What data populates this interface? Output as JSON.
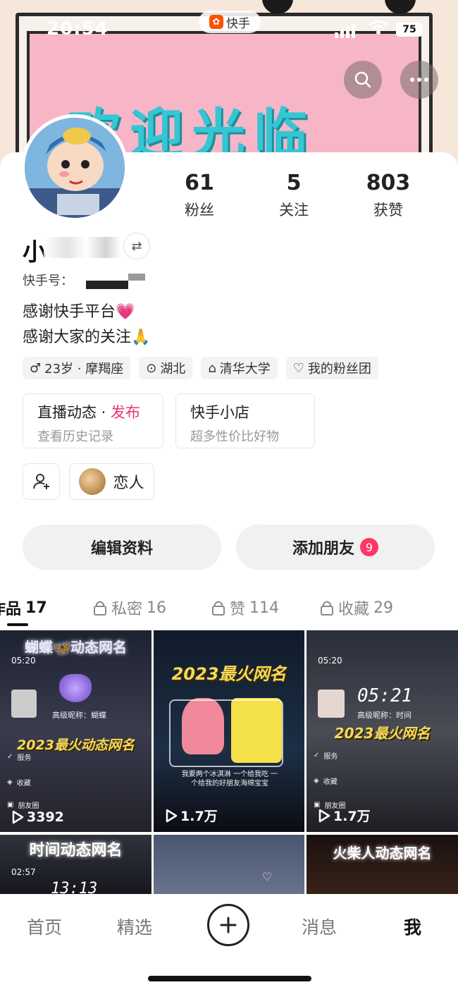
{
  "status_bar": {
    "time": "20:54",
    "app_name": "快手",
    "battery": "75"
  },
  "cover": {
    "banner_text": "欢迎光临"
  },
  "profile": {
    "nickname": "小",
    "kuaishou_id_label": "快手号：",
    "bio_line1": "感谢快手平台💗",
    "bio_line2": "感谢大家的关注🙏",
    "stats": [
      {
        "num": "61",
        "label": "粉丝"
      },
      {
        "num": "5",
        "label": "关注"
      },
      {
        "num": "803",
        "label": "获赞"
      }
    ],
    "tags": [
      {
        "icon": "male-icon",
        "glyph": "♂",
        "label": "23岁 · 摩羯座"
      },
      {
        "icon": "location-icon",
        "glyph": "⊙",
        "label": "湖北"
      },
      {
        "icon": "graduation-cap-icon",
        "glyph": "🎓",
        "label": "清华大学"
      },
      {
        "icon": "fan-group-icon",
        "glyph": "♡",
        "label": "我的粉丝团"
      }
    ]
  },
  "cards": {
    "live": {
      "title": "直播动态",
      "separator": " · ",
      "publish": "发布",
      "sub": "查看历史记录"
    },
    "shop": {
      "title": "快手小店",
      "sub": "超多性价比好物"
    }
  },
  "relations": {
    "lover_label": "恋人"
  },
  "actions": {
    "edit_profile": "编辑资料",
    "add_friend": "添加朋友",
    "add_friend_badge": "9"
  },
  "tabs": [
    {
      "label": "作品",
      "count": "17"
    },
    {
      "label": "私密",
      "count": "16"
    },
    {
      "label": "赞",
      "count": "114"
    },
    {
      "label": "收藏",
      "count": "29"
    }
  ],
  "grid": [
    {
      "title_top": "蝴蝶🦋动态网名",
      "time": "05:20",
      "overlay": "2023最火动态网名",
      "nickname_line": "高级昵称：蝴蝶",
      "menu": [
        "服务",
        "收藏",
        "朋友圈"
      ],
      "plays": "3392"
    },
    {
      "title_top": "2023最火网名",
      "overlay": "我要两个冰淇淋 一个给我吃 一个给我的好朋友海绵宝宝",
      "plays": "1.7万"
    },
    {
      "time": "05:20",
      "clock": "05:21",
      "nickname_line": "高级昵称：时间",
      "overlay": "2023最火网名",
      "menu": [
        "服务",
        "收藏",
        "朋友圈"
      ],
      "plays": "1.7万"
    },
    {
      "title_top": "时间动态网名",
      "time": "02:57",
      "clock": "13:13"
    },
    {},
    {
      "title_top": "火柴人动态网名"
    }
  ],
  "bottom_nav": [
    {
      "label": "首页"
    },
    {
      "label": "精选"
    },
    {
      "label": "消息"
    },
    {
      "label": "我"
    }
  ],
  "colors": {
    "accent_pink": "#e8356d",
    "badge_red": "#fe3666",
    "banner_cyan": "#35c6d4",
    "banner_pink": "#f7b5c8"
  }
}
